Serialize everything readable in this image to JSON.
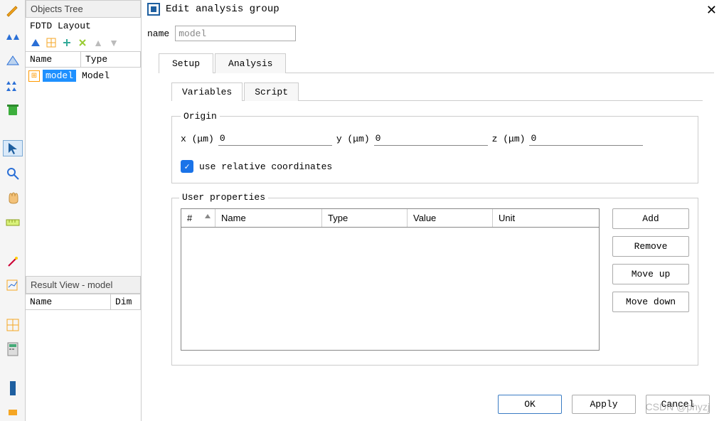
{
  "left_panel": {
    "objects_title": "Objects Tree",
    "fdtd_label": "FDTD Layout",
    "tree_cols": {
      "name": "Name",
      "type": "Type"
    },
    "tree_row": {
      "name": "model",
      "type": "Model"
    },
    "result_title": "Result View - model",
    "result_cols": {
      "name": "Name",
      "dim": "Dim"
    }
  },
  "dialog": {
    "title": "Edit analysis group",
    "close": "✕",
    "name_label": "name",
    "name_value": "model",
    "tabs": {
      "setup": "Setup",
      "analysis": "Analysis"
    },
    "inner_tabs": {
      "variables": "Variables",
      "script": "Script"
    },
    "origin": {
      "legend": "Origin",
      "x_label": "x (μm)",
      "x_value": "0",
      "y_label": "y (μm)",
      "y_value": "0",
      "z_label": "z (μm)",
      "z_value": "0",
      "chk_label": "use relative coordinates"
    },
    "userprops": {
      "legend": "User properties",
      "cols": {
        "num": "#",
        "name": "Name",
        "type": "Type",
        "value": "Value",
        "unit": "Unit"
      },
      "buttons": {
        "add": "Add",
        "remove": "Remove",
        "moveup": "Move up",
        "movedown": "Move down"
      }
    },
    "bottom": {
      "ok": "OK",
      "apply": "Apply",
      "cancel": "Cancel"
    }
  },
  "watermark": "CSDN @phyzj"
}
